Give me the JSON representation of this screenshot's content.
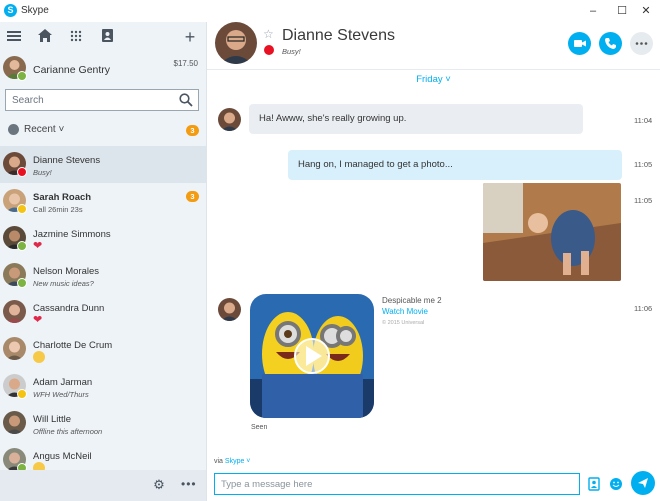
{
  "window": {
    "app_title": "Skype",
    "minimize": "–",
    "maximize": "☐",
    "close": "✕"
  },
  "toolbar": {
    "menu_icon": "hamburger-icon",
    "home_icon": "home-icon",
    "dialpad_icon": "dialpad-icon",
    "contacts_icon": "contacts-icon",
    "add_icon": "plus-icon"
  },
  "me": {
    "name": "Carianne Gentry",
    "credit": "$17.50"
  },
  "search": {
    "placeholder": "Search"
  },
  "recent": {
    "label": "Recent",
    "count": "3"
  },
  "contacts": [
    {
      "name": "Dianne Stevens",
      "sub": "Busy!",
      "status": "busy",
      "active": true
    },
    {
      "name": "Sarah Roach",
      "sub": "Call 26min 23s",
      "status": "away",
      "badge": "3",
      "bold": true
    },
    {
      "name": "Jazmine Simmons",
      "sub": "",
      "mood": "heart",
      "status": "online"
    },
    {
      "name": "Nelson Morales",
      "sub": "New music ideas?",
      "status": "online"
    },
    {
      "name": "Cassandra Dunn",
      "sub": "",
      "mood": "heart",
      "status": "none"
    },
    {
      "name": "Charlotte De Crum",
      "sub": "",
      "mood": "smile",
      "status": "none"
    },
    {
      "name": "Adam Jarman",
      "sub": "WFH Wed/Thurs",
      "status": "away"
    },
    {
      "name": "Will Little",
      "sub": "Offline this afternoon",
      "status": "none"
    },
    {
      "name": "Angus McNeil",
      "sub": "",
      "mood": "smile",
      "status": "online"
    }
  ],
  "footer": {
    "settings_icon": "gear-icon",
    "more_icon": "more-icon"
  },
  "conversation": {
    "name": "Dianne Stevens",
    "status": "Busy!",
    "day": "Friday ˅",
    "messages": [
      {
        "text": "Ha! Awww, she's really growing up.",
        "time": "11:04",
        "dir": "in"
      },
      {
        "text": "Hang on, I managed to get a photo...",
        "time": "11:05",
        "dir": "out"
      },
      {
        "text": "",
        "time": "11:05",
        "dir": "out",
        "kind": "photo"
      },
      {
        "text": "",
        "time": "11:06",
        "dir": "in",
        "kind": "movie"
      }
    ],
    "movie": {
      "title": "Despicable me 2",
      "link": "Watch Movie",
      "copyright": "© 2015 Universal"
    },
    "seen": "Seen",
    "via_prefix": "via",
    "via_service": "Skype ˅",
    "composer_placeholder": "Type a message here"
  },
  "colors": {
    "accent": "#00aff0",
    "busy": "#e81123",
    "online": "#7cb342",
    "away": "#f5c311",
    "badge": "#f39c12"
  }
}
